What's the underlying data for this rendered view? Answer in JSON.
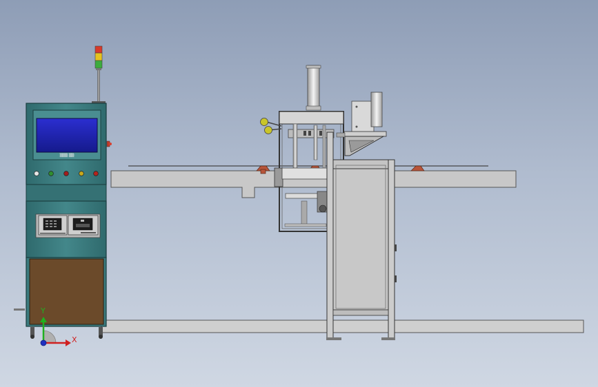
{
  "viewport": {
    "background_top": "#8e9db6",
    "background_bottom": "#cfd7e3"
  },
  "colors": {
    "cabinet_teal": "#3d7d80",
    "screen_blue": "#2222aa",
    "cabinet_door": "#6b4a2a",
    "conveyor_gray": "#c8c8c8",
    "lamp_red": "#d83a2a",
    "lamp_yellow": "#e6c21f",
    "lamp_green": "#3cab3c",
    "axis_x": "#d02020",
    "axis_y": "#20b020"
  },
  "hmi": {
    "screen_text": "▒▒▒ ▒▒"
  },
  "triad": {
    "x_label": "X",
    "y_label": "Y"
  }
}
